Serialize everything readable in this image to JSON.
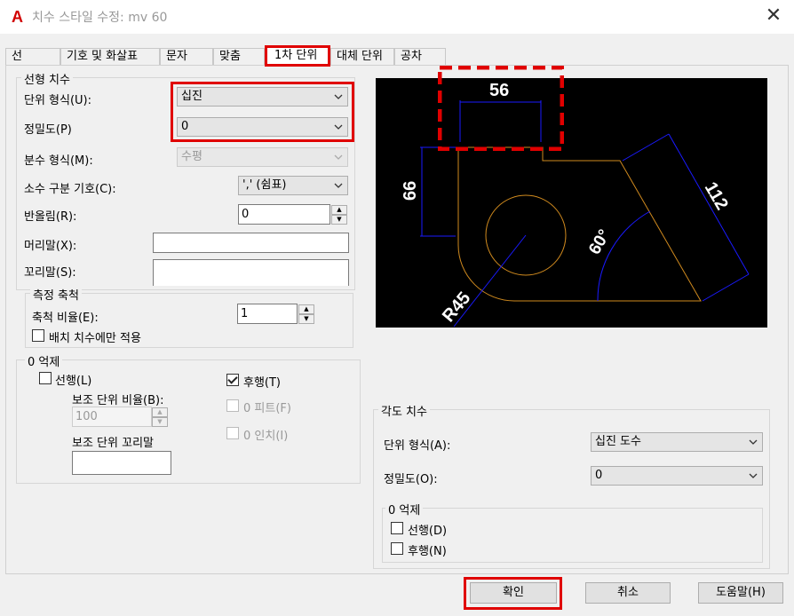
{
  "window": {
    "title": "치수 스타일 수정: mv 60",
    "close": "✕",
    "app_icon_letter": "A"
  },
  "tabs": [
    "선",
    "기호 및 화살표",
    "문자",
    "맞춤",
    "1차 단위",
    "대체 단위",
    "공차"
  ],
  "linear": {
    "legend": "선형 치수",
    "unit_format_label": "단위 형식(U):",
    "unit_format_value": "십진",
    "precision_label": "정밀도(P)",
    "precision_value": "0",
    "fraction_label": "분수 형식(M):",
    "fraction_value": "수평",
    "decimal_sep_label": "소수 구분 기호(C):",
    "decimal_sep_value": "','  (쉼표)",
    "roundoff_label": "반올림(R):",
    "roundoff_value": "0",
    "prefix_label": "머리말(X):",
    "prefix_value": "",
    "suffix_label": "꼬리말(S):",
    "suffix_value": ""
  },
  "scale": {
    "legend": "측정 축척",
    "factor_label": "축척 비율(E):",
    "factor_value": "1",
    "layout_only_label": "배치 치수에만 적용"
  },
  "zero_linear": {
    "legend": "0 억제",
    "leading_label": "선행(L)",
    "sub_factor_label": "보조 단위 비율(B):",
    "sub_factor_value": "100",
    "sub_suffix_label": "보조 단위 꼬리말",
    "sub_suffix_value": "",
    "trailing_label": "후행(T)",
    "feet_label": "0 피트(F)",
    "inches_label": "0 인치(I)"
  },
  "angular": {
    "legend": "각도 치수",
    "unit_format_label": "단위 형식(A):",
    "unit_format_value": "십진 도수",
    "precision_label": "정밀도(O):",
    "precision_value": "0"
  },
  "zero_angular": {
    "legend": "0 억제",
    "leading_label": "선행(D)",
    "trailing_label": "후행(N)"
  },
  "preview": {
    "dim_top": "56",
    "dim_left": "66",
    "dim_right": "112",
    "dim_angle": "60°",
    "dim_radius": "R45"
  },
  "buttons": {
    "ok": "확인",
    "cancel": "취소",
    "help": "도움말(H)"
  },
  "colors": {
    "highlight": "#e00000",
    "geometry": "#d08a1e",
    "dimension": "#1a1aff",
    "preview_bg": "#000000"
  }
}
